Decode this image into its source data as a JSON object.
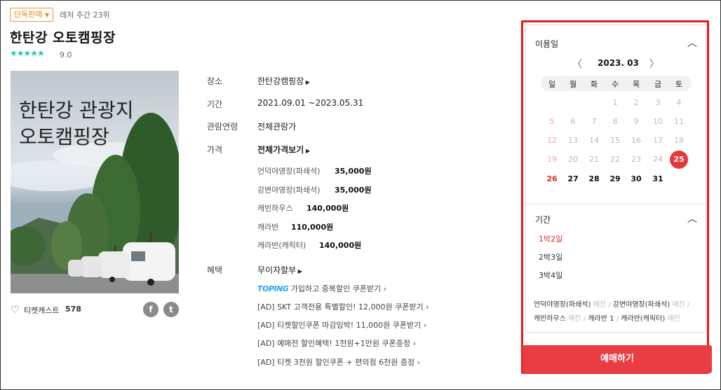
{
  "header": {
    "badge": "단독판매",
    "rank": "레저 주간 23위",
    "title": "한탄강 오토캠핑장",
    "stars": "★★★★★",
    "rating": "9.0"
  },
  "poster": {
    "line1": "한탄강 관광지",
    "line2": "오토캠핑장"
  },
  "social": {
    "cast_label": "티켓캐스트",
    "cast_count": "578",
    "facebook": "f",
    "twitter": "t"
  },
  "info": {
    "place_label": "장소",
    "place_value": "한탄강캠핑장",
    "period_label": "기간",
    "period_value": "2021.09.01 ~2023.05.31",
    "age_label": "관람연령",
    "age_value": "전체관람가",
    "price_label": "가격",
    "price_all": "전체가격보기",
    "prices": [
      {
        "name": "언덕야영장(파쇄석)",
        "value": "35,000원"
      },
      {
        "name": "강변야영장(파쇄석)",
        "value": "35,000원"
      },
      {
        "name": "캐빈하우스",
        "value": "140,000원"
      },
      {
        "name": "캐라반",
        "value": "110,000원"
      },
      {
        "name": "캐라반(캐릭터)",
        "value": "140,000원"
      }
    ],
    "benefit_label": "혜택",
    "benefit_value": "무이자할부",
    "toping_brand": "TOPING",
    "toping_text": "가입하고 중복할인 쿠폰받기",
    "ads": [
      "[AD] SKT 고객전용 특별할인! 12,000원 쿠폰받기",
      "[AD] 티켓할인쿠폰 마감임박! 11,000원 쿠폰받기",
      "[AD] 예매전 할인혜택! 1천원+1만원 쿠폰증정",
      "[AD] 티켓 3천원 할인쿠폰 + 편의점 6천원 증정"
    ]
  },
  "calendar": {
    "section_title": "이용일",
    "month": "2023. 03",
    "prev": "〈",
    "next": "〉",
    "weekdays": [
      "일",
      "월",
      "화",
      "수",
      "목",
      "금",
      "토"
    ],
    "selected_day": "25"
  },
  "duration": {
    "section_title": "기간",
    "options": [
      "1박2일",
      "2박3일",
      "3박4일"
    ]
  },
  "seats": {
    "a": "언덕야영장(파쇄석)",
    "a_status": "매진",
    "b": "강변야영장(파쇄석)",
    "b_status": "매진",
    "c": "캐빈하우스",
    "c_status": "매진",
    "d": "캐라반 1",
    "e": "캐라반(캐릭터)",
    "e_status": "매진"
  },
  "book_button": "예매하기",
  "colors": {
    "accent_red": "#e5383c",
    "star_teal": "#2bc5b4",
    "badge_orange": "#e08a16"
  }
}
